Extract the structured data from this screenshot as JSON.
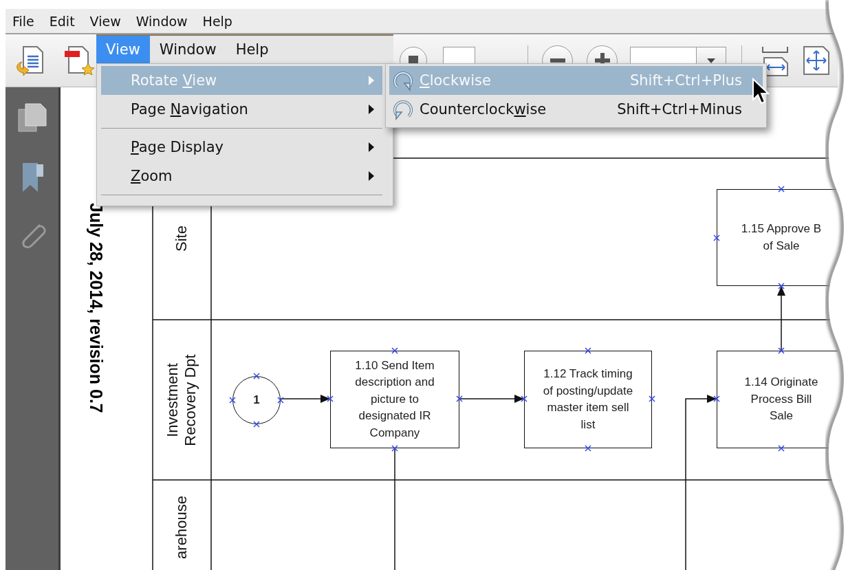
{
  "menu_bar": [
    "File",
    "Edit",
    "View",
    "Window",
    "Help"
  ],
  "overlay_menu_bar": [
    {
      "label": "View",
      "selected": true
    },
    {
      "label": "Window",
      "selected": false
    },
    {
      "label": "Help",
      "selected": false
    }
  ],
  "view_menu": [
    {
      "kind": "item",
      "selected": true,
      "parts": [
        {
          "text": "Rotate ",
          "underline": false
        },
        {
          "text": "V",
          "underline": true
        },
        {
          "text": "iew",
          "underline": false
        }
      ]
    },
    {
      "kind": "item",
      "selected": false,
      "parts": [
        {
          "text": "Page ",
          "underline": false
        },
        {
          "text": "N",
          "underline": true
        },
        {
          "text": "avigation",
          "underline": false
        }
      ]
    },
    {
      "kind": "separator"
    },
    {
      "kind": "item",
      "selected": false,
      "parts": [
        {
          "text": "P",
          "underline": true
        },
        {
          "text": "age Display",
          "underline": false
        }
      ]
    },
    {
      "kind": "item",
      "selected": false,
      "parts": [
        {
          "text": "Z",
          "underline": true
        },
        {
          "text": "oom",
          "underline": false
        }
      ]
    },
    {
      "kind": "separator"
    }
  ],
  "rotate_submenu": [
    {
      "selected": true,
      "shortcut": "Shift+Ctrl+Plus",
      "parts": [
        {
          "text": "C",
          "underline": true
        },
        {
          "text": "lockwise",
          "underline": false
        }
      ]
    },
    {
      "selected": false,
      "shortcut": "Shift+Ctrl+Minus",
      "parts": [
        {
          "text": "Counterclock",
          "underline": false
        },
        {
          "text": "w",
          "underline": true
        },
        {
          "text": "ise",
          "underline": false
        }
      ]
    }
  ],
  "document": {
    "header": "July 28, 2014, revision 0.7",
    "lanes": [
      {
        "label": "Site"
      },
      {
        "label": "Investment\nRecovery Dpt"
      },
      {
        "label": "arehouse"
      }
    ],
    "nodes": [
      {
        "kind": "task",
        "label": "1.15 Approve B\nof Sale"
      },
      {
        "kind": "start",
        "label": "1"
      },
      {
        "kind": "task",
        "label": "1.10 Send Item\ndescription and\npicture to\ndesignated IR\nCompany"
      },
      {
        "kind": "task",
        "label": "1.12 Track timing\nof posting/update\nmaster item sell\nlist"
      },
      {
        "kind": "task",
        "label": "1.14 Originate\nProcess Bill\nSale"
      }
    ]
  }
}
